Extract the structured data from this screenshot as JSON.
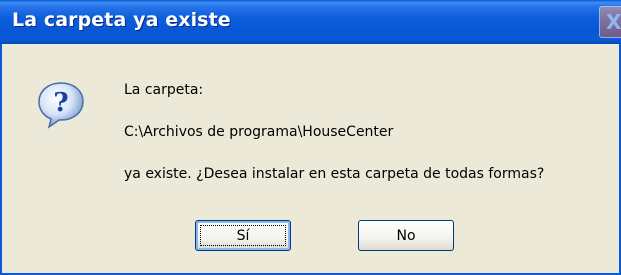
{
  "dialog": {
    "title": "La carpeta ya existe",
    "close_glyph": "X",
    "icon": "question-icon",
    "message_line_1": "La carpeta:",
    "message_line_2": "C:\\Archivos de programa\\HouseCenter",
    "message_line_3": "ya existe. ¿Desea instalar en esta carpeta de todas formas?",
    "buttons": {
      "yes_label": "Sí",
      "no_label": "No"
    }
  },
  "colors": {
    "titlebar": "#0a5ad8",
    "dialog_background": "#ece9d8",
    "button_border": "#003c74"
  }
}
